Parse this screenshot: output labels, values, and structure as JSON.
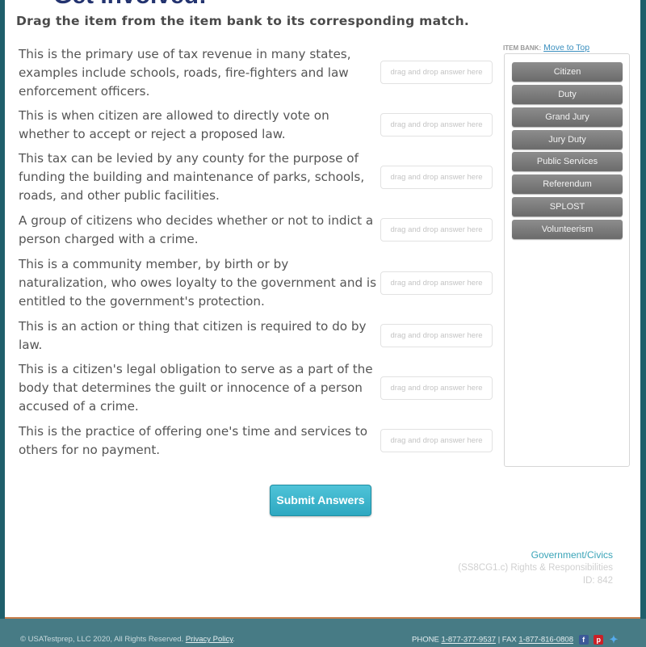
{
  "page": {
    "title": "Get Involved!",
    "instruction": "Drag the item from the item bank to its corresponding match."
  },
  "questions": [
    {
      "text": "This is the primary use of tax revenue in many states, examples include schools, roads, fire-fighters and law enforcement officers.",
      "dropzone_placeholder": "drag and drop answer here"
    },
    {
      "text": "This is when citizen are allowed to directly vote on whether to accept or reject a proposed law.",
      "dropzone_placeholder": "drag and drop answer here"
    },
    {
      "text": "This tax can be levied by any county for the purpose of funding the building and maintenance of parks, schools, roads, and other public facilities.",
      "dropzone_placeholder": "drag and drop answer here"
    },
    {
      "text": "A group of citizens who decides whether or not to indict a person charged with a crime.",
      "dropzone_placeholder": "drag and drop answer here"
    },
    {
      "text": "This is a community member, by birth or by naturalization, who owes loyalty to the government and is entitled to the government's protection.",
      "dropzone_placeholder": "drag and drop answer here"
    },
    {
      "text": "This is an action or thing that citizen is required to do by law.",
      "dropzone_placeholder": "drag and drop answer here"
    },
    {
      "text": "This is a citizen's legal obligation to serve as a part of the body that determines the guilt or innocence of a person accused of a crime.",
      "dropzone_placeholder": "drag and drop answer here"
    },
    {
      "text": "This is the practice of offering one's time and services to others for no payment.",
      "dropzone_placeholder": "drag and drop answer here"
    }
  ],
  "item_bank": {
    "label": "ITEM BANK:",
    "move_to_top": "Move to Top",
    "items": [
      "Citizen",
      "Duty",
      "Grand Jury",
      "Jury Duty",
      "Public Services",
      "Referendum",
      "SPLOST",
      "Volunteerism"
    ]
  },
  "submit_label": "Submit Answers",
  "meta": {
    "subject": "Government/Civics",
    "standard": "(SS8CG1.c) Rights & Responsibilities",
    "id": "ID: 842"
  },
  "footer": {
    "copyright": "© USATestprep, LLC 2020, All Rights Reserved.",
    "privacy": "Privacy Policy",
    "phone_label": "PHONE",
    "phone": "1-877-377-9537",
    "fax_label": "| FAX",
    "fax": "1-877-816-0808",
    "social": [
      "facebook-icon",
      "pinterest-icon",
      "twitter-icon"
    ]
  },
  "colors": {
    "teal_dark": "#1f5f6b",
    "teal_footer": "#477b85",
    "accent": "#2ea8c1",
    "title": "#23336f"
  }
}
